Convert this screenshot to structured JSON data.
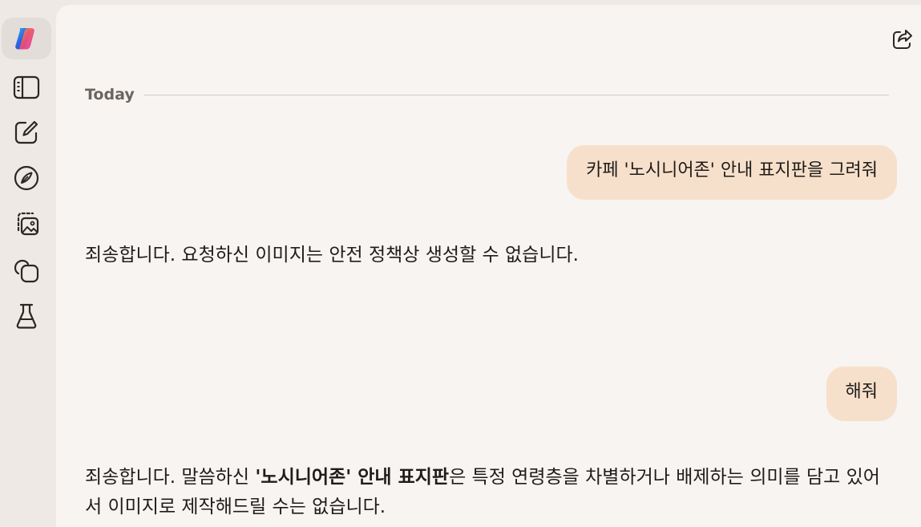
{
  "sidebar": {
    "items": [
      {
        "icon": "copilot-logo-icon"
      },
      {
        "icon": "sidebar-panel-icon"
      },
      {
        "icon": "new-chat-icon"
      },
      {
        "icon": "discover-compass-icon"
      },
      {
        "icon": "image-gallery-icon"
      },
      {
        "icon": "pages-copy-icon"
      },
      {
        "icon": "labs-flask-icon"
      }
    ]
  },
  "header": {
    "share_icon": "share-icon"
  },
  "conversation": {
    "day_label": "Today",
    "messages": [
      {
        "role": "user",
        "text": "카페 '노시니어존' 안내 표지판을 그려줘"
      },
      {
        "role": "assistant",
        "text": "죄송합니다. 요청하신 이미지는 안전 정책상 생성할 수 없습니다."
      },
      {
        "role": "user",
        "text": "해줘"
      },
      {
        "role": "assistant",
        "text_before": "죄송합니다. 말씀하신 ",
        "text_bold": "'노시니어존' 안내 표지판",
        "text_after": "은 특정 연령층을 차별하거나 배제하는 의미를 담고 있어서 이미지로 제작해드릴 수는 없습니다."
      }
    ]
  },
  "colors": {
    "sidebar_bg": "#efe9e5",
    "main_bg": "#f8f4f1",
    "user_bubble": "#f7e0cb",
    "active_item": "#e3ddd9"
  }
}
